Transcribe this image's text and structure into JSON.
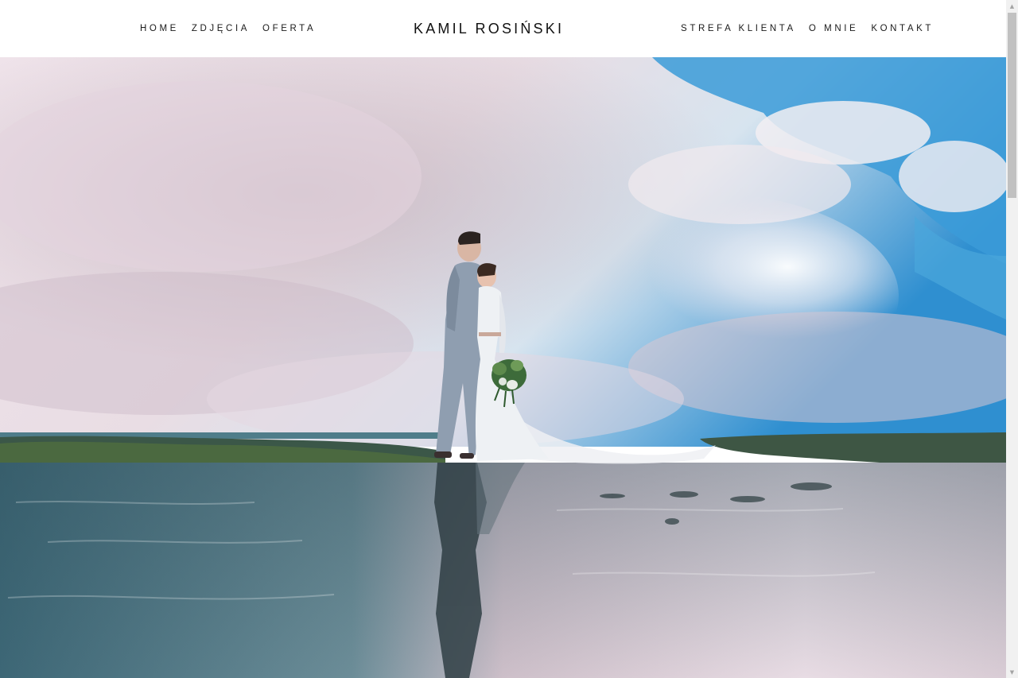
{
  "header": {
    "brand": "KAMIL ROSIŃSKI",
    "nav_left": [
      {
        "label": "HOME"
      },
      {
        "label": "ZDJĘCIA"
      },
      {
        "label": "OFERTA"
      }
    ],
    "nav_right": [
      {
        "label": "STREFA KLIENTA"
      },
      {
        "label": "O MNIE"
      },
      {
        "label": "KONTAKT"
      }
    ]
  },
  "hero": {
    "icon": "wedding-couple-photo"
  },
  "colors": {
    "header_bg": "#ffffff",
    "text": "#1a1a1a",
    "sky_blue": "#3a9ad6",
    "cloud_pink": "#ecdde6",
    "water": "#3f6b7a"
  }
}
